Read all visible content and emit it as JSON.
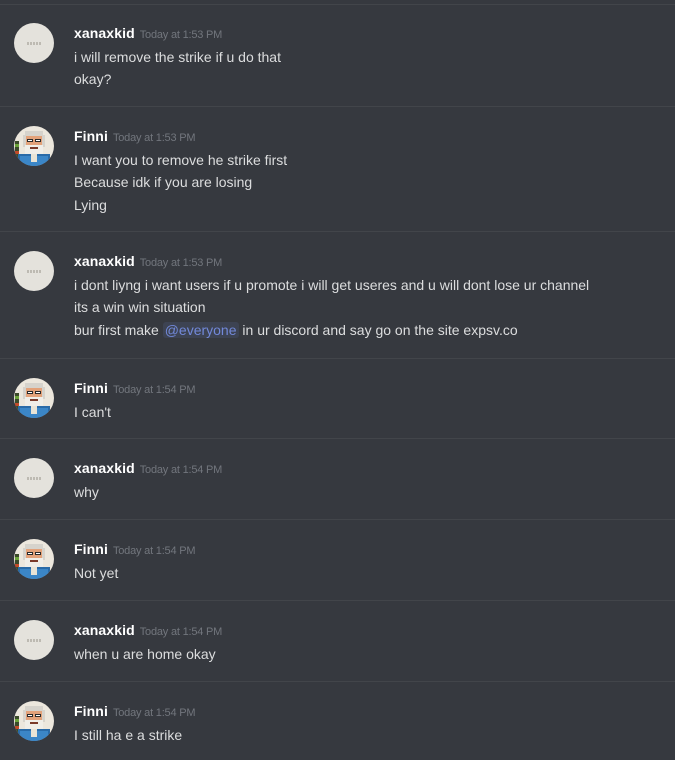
{
  "messages": [
    {
      "username": "xanaxkid",
      "timestamp": "Today at 1:53 PM",
      "avatar": "blank-avatar",
      "lines": [
        "i will remove the strike if u do that",
        "okay?"
      ]
    },
    {
      "username": "Finni",
      "timestamp": "Today at 1:53 PM",
      "avatar": "pixel-old-man-avatar",
      "lines": [
        "I want you to remove he strike first",
        "Because idk if you are losing",
        "Lying"
      ]
    },
    {
      "username": "xanaxkid",
      "timestamp": "Today at 1:53 PM",
      "avatar": "blank-avatar",
      "lines": [
        "i dont liyng i want users if u promote i will get useres and u will dont lose ur channel",
        "its a win win situation"
      ],
      "mention_line": {
        "before": "bur first make ",
        "mention": "@everyone",
        "after": " in ur discord and say go on the site expsv.co"
      }
    },
    {
      "username": "Finni",
      "timestamp": "Today at 1:54 PM",
      "avatar": "pixel-old-man-avatar",
      "lines": [
        "I can't"
      ]
    },
    {
      "username": "xanaxkid",
      "timestamp": "Today at 1:54 PM",
      "avatar": "blank-avatar",
      "lines": [
        "why"
      ]
    },
    {
      "username": "Finni",
      "timestamp": "Today at 1:54 PM",
      "avatar": "pixel-old-man-avatar",
      "lines": [
        "Not yet"
      ]
    },
    {
      "username": "xanaxkid",
      "timestamp": "Today at 1:54 PM",
      "avatar": "blank-avatar",
      "lines": [
        "when u are home okay"
      ]
    },
    {
      "username": "Finni",
      "timestamp": "Today at 1:54 PM",
      "avatar": "pixel-old-man-avatar",
      "lines": [
        "I still ha e a strike"
      ]
    }
  ],
  "colors": {
    "background": "#36393f",
    "divider": "#42454a",
    "username": "#ffffff",
    "timestamp": "#72767d",
    "message_text": "#dcddde",
    "mention": "#7289da"
  }
}
